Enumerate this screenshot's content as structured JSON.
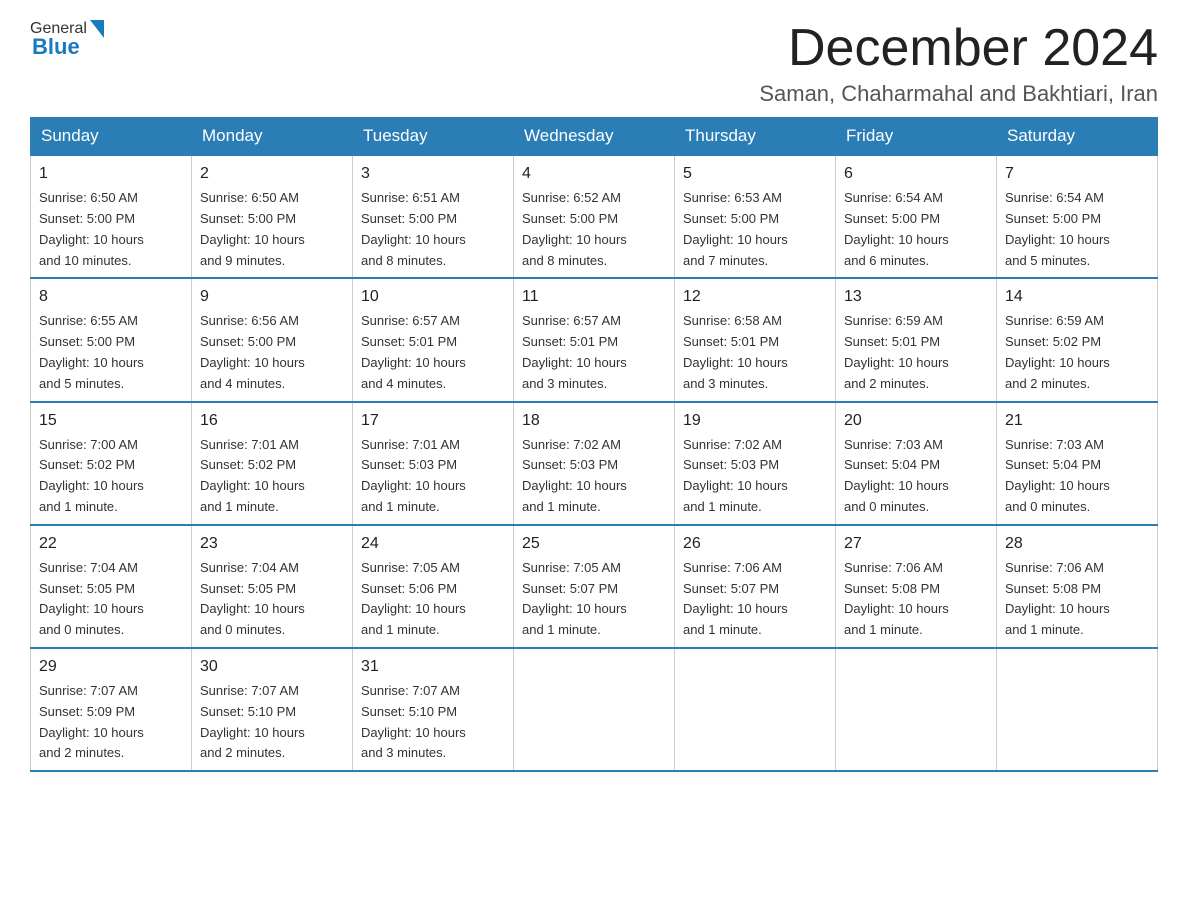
{
  "header": {
    "logo_general": "General",
    "logo_blue": "Blue",
    "month_title": "December 2024",
    "subtitle": "Saman, Chaharmahal and Bakhtiari, Iran"
  },
  "days_of_week": [
    "Sunday",
    "Monday",
    "Tuesday",
    "Wednesday",
    "Thursday",
    "Friday",
    "Saturday"
  ],
  "weeks": [
    [
      {
        "day": "1",
        "sunrise": "6:50 AM",
        "sunset": "5:00 PM",
        "daylight": "10 hours and 10 minutes."
      },
      {
        "day": "2",
        "sunrise": "6:50 AM",
        "sunset": "5:00 PM",
        "daylight": "10 hours and 9 minutes."
      },
      {
        "day": "3",
        "sunrise": "6:51 AM",
        "sunset": "5:00 PM",
        "daylight": "10 hours and 8 minutes."
      },
      {
        "day": "4",
        "sunrise": "6:52 AM",
        "sunset": "5:00 PM",
        "daylight": "10 hours and 8 minutes."
      },
      {
        "day": "5",
        "sunrise": "6:53 AM",
        "sunset": "5:00 PM",
        "daylight": "10 hours and 7 minutes."
      },
      {
        "day": "6",
        "sunrise": "6:54 AM",
        "sunset": "5:00 PM",
        "daylight": "10 hours and 6 minutes."
      },
      {
        "day": "7",
        "sunrise": "6:54 AM",
        "sunset": "5:00 PM",
        "daylight": "10 hours and 5 minutes."
      }
    ],
    [
      {
        "day": "8",
        "sunrise": "6:55 AM",
        "sunset": "5:00 PM",
        "daylight": "10 hours and 5 minutes."
      },
      {
        "day": "9",
        "sunrise": "6:56 AM",
        "sunset": "5:00 PM",
        "daylight": "10 hours and 4 minutes."
      },
      {
        "day": "10",
        "sunrise": "6:57 AM",
        "sunset": "5:01 PM",
        "daylight": "10 hours and 4 minutes."
      },
      {
        "day": "11",
        "sunrise": "6:57 AM",
        "sunset": "5:01 PM",
        "daylight": "10 hours and 3 minutes."
      },
      {
        "day": "12",
        "sunrise": "6:58 AM",
        "sunset": "5:01 PM",
        "daylight": "10 hours and 3 minutes."
      },
      {
        "day": "13",
        "sunrise": "6:59 AM",
        "sunset": "5:01 PM",
        "daylight": "10 hours and 2 minutes."
      },
      {
        "day": "14",
        "sunrise": "6:59 AM",
        "sunset": "5:02 PM",
        "daylight": "10 hours and 2 minutes."
      }
    ],
    [
      {
        "day": "15",
        "sunrise": "7:00 AM",
        "sunset": "5:02 PM",
        "daylight": "10 hours and 1 minute."
      },
      {
        "day": "16",
        "sunrise": "7:01 AM",
        "sunset": "5:02 PM",
        "daylight": "10 hours and 1 minute."
      },
      {
        "day": "17",
        "sunrise": "7:01 AM",
        "sunset": "5:03 PM",
        "daylight": "10 hours and 1 minute."
      },
      {
        "day": "18",
        "sunrise": "7:02 AM",
        "sunset": "5:03 PM",
        "daylight": "10 hours and 1 minute."
      },
      {
        "day": "19",
        "sunrise": "7:02 AM",
        "sunset": "5:03 PM",
        "daylight": "10 hours and 1 minute."
      },
      {
        "day": "20",
        "sunrise": "7:03 AM",
        "sunset": "5:04 PM",
        "daylight": "10 hours and 0 minutes."
      },
      {
        "day": "21",
        "sunrise": "7:03 AM",
        "sunset": "5:04 PM",
        "daylight": "10 hours and 0 minutes."
      }
    ],
    [
      {
        "day": "22",
        "sunrise": "7:04 AM",
        "sunset": "5:05 PM",
        "daylight": "10 hours and 0 minutes."
      },
      {
        "day": "23",
        "sunrise": "7:04 AM",
        "sunset": "5:05 PM",
        "daylight": "10 hours and 0 minutes."
      },
      {
        "day": "24",
        "sunrise": "7:05 AM",
        "sunset": "5:06 PM",
        "daylight": "10 hours and 1 minute."
      },
      {
        "day": "25",
        "sunrise": "7:05 AM",
        "sunset": "5:07 PM",
        "daylight": "10 hours and 1 minute."
      },
      {
        "day": "26",
        "sunrise": "7:06 AM",
        "sunset": "5:07 PM",
        "daylight": "10 hours and 1 minute."
      },
      {
        "day": "27",
        "sunrise": "7:06 AM",
        "sunset": "5:08 PM",
        "daylight": "10 hours and 1 minute."
      },
      {
        "day": "28",
        "sunrise": "7:06 AM",
        "sunset": "5:08 PM",
        "daylight": "10 hours and 1 minute."
      }
    ],
    [
      {
        "day": "29",
        "sunrise": "7:07 AM",
        "sunset": "5:09 PM",
        "daylight": "10 hours and 2 minutes."
      },
      {
        "day": "30",
        "sunrise": "7:07 AM",
        "sunset": "5:10 PM",
        "daylight": "10 hours and 2 minutes."
      },
      {
        "day": "31",
        "sunrise": "7:07 AM",
        "sunset": "5:10 PM",
        "daylight": "10 hours and 3 minutes."
      },
      null,
      null,
      null,
      null
    ]
  ],
  "labels": {
    "sunrise": "Sunrise:",
    "sunset": "Sunset:",
    "daylight": "Daylight:"
  }
}
